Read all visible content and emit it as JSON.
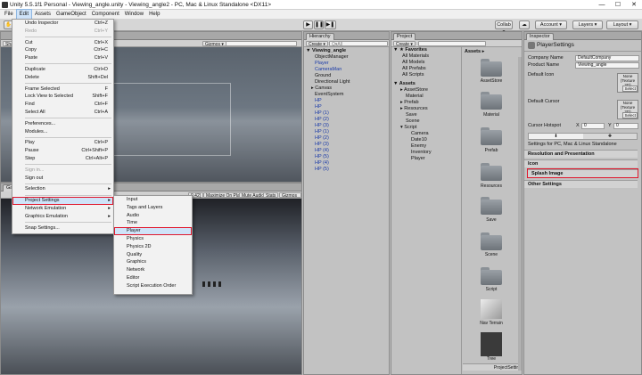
{
  "window": {
    "title": "Unity 5.5.1f1 Personal - Viewing_angle.unity - Viewing_angle2 - PC, Mac & Linux Standalone <DX11>"
  },
  "menubar": [
    "File",
    "Edit",
    "Assets",
    "GameObject",
    "Component",
    "Window",
    "Help"
  ],
  "toolbar": {
    "collab": "Collab ▾",
    "account": "Account ▾",
    "layers": "Layers ▾",
    "layout": "Layout ▾",
    "play": "▶",
    "pause": "❚❚",
    "step": "▶❚"
  },
  "scene": {
    "gizmos": "Gizmos ▾",
    "shaded": "Shaded"
  },
  "game": {
    "tab": "Game",
    "scale": "0.42)",
    "maximize": "Maximize On Play",
    "mute": "Mute Audio",
    "stats": "Stats",
    "gizmos": "Gizmos ▾"
  },
  "hierarchy": {
    "tab": "Hierarchy",
    "create": "Create ▾",
    "search_placeholder": "Q▾All",
    "root": "▼ Viewing_angle",
    "items": [
      "ObjectManager",
      "Player",
      "CameraMan",
      "Ground",
      "Directional Light",
      "Canvas",
      "EventSystem",
      "HP",
      "HP",
      "HP (1)",
      "HP (2)",
      "HP (3)",
      "HP (1)",
      "HP (2)",
      "HP (3)",
      "HP (4)",
      "HP (5)",
      "HP (4)",
      "HP (5)"
    ]
  },
  "project": {
    "tab": "Project",
    "create": "Create ▾",
    "favorites": "▼ ★ Favorites",
    "fav_items": [
      "All Materials",
      "All Models",
      "All Prefabs",
      "All Scripts"
    ],
    "assets_root": "▼ Assets",
    "tree": [
      "AssetStore",
      "Material",
      "Prefab",
      "Resources",
      "Save",
      "Scene",
      "Script",
      "Camera",
      "Date10",
      "Enemy",
      "Inventory",
      "Player"
    ],
    "breadcrumb": "Assets ▸",
    "grid": [
      "AssetStore",
      "Material",
      "Prefab",
      "Resources",
      "Save",
      "Scene",
      "Script",
      "Nav Terrain",
      "Tree"
    ],
    "footer": "ProjectSettir"
  },
  "inspector": {
    "tab": "Inspector",
    "title": "PlayerSettings",
    "company_label": "Company Name",
    "company_value": "DefaultCompany",
    "product_label": "Product Name",
    "product_value": "Viewing_angle",
    "default_icon_label": "Default Icon",
    "default_cursor_label": "Default Cursor",
    "tex_none": "None (Texture 2D)",
    "tex_select": "Select",
    "hotspot_label": "Cursor Hotspot",
    "hotspot_x_label": "X",
    "hotspot_x": "0",
    "hotspot_y_label": "Y",
    "hotspot_y": "0",
    "settings_for": "Settings for PC, Mac & Linux Standalone",
    "sections": [
      "Resolution and Presentation",
      "Icon",
      "Splash Image",
      "Other Settings"
    ]
  },
  "edit_menu": [
    {
      "label": "Undo Inspector",
      "shortcut": "Ctrl+Z"
    },
    {
      "label": "Redo",
      "shortcut": "Ctrl+Y"
    },
    {
      "label": "Cut",
      "shortcut": "Ctrl+X"
    },
    {
      "label": "Copy",
      "shortcut": "Ctrl+C"
    },
    {
      "label": "Paste",
      "shortcut": "Ctrl+V"
    },
    {
      "label": "Duplicate",
      "shortcut": "Ctrl+D"
    },
    {
      "label": "Delete",
      "shortcut": "Shift+Del"
    },
    {
      "label": "Frame Selected",
      "shortcut": "F"
    },
    {
      "label": "Lock View to Selected",
      "shortcut": "Shift+F"
    },
    {
      "label": "Find",
      "shortcut": "Ctrl+F"
    },
    {
      "label": "Select All",
      "shortcut": "Ctrl+A"
    },
    {
      "label": "Preferences...",
      "shortcut": ""
    },
    {
      "label": "Modules...",
      "shortcut": ""
    },
    {
      "label": "Play",
      "shortcut": "Ctrl+P"
    },
    {
      "label": "Pause",
      "shortcut": "Ctrl+Shift+P"
    },
    {
      "label": "Step",
      "shortcut": "Ctrl+Alt+P"
    },
    {
      "label": "Sign in...",
      "shortcut": ""
    },
    {
      "label": "Sign out",
      "shortcut": ""
    },
    {
      "label": "Selection",
      "shortcut": ""
    },
    {
      "label": "Project Settings",
      "shortcut": ""
    },
    {
      "label": "Network Emulation",
      "shortcut": ""
    },
    {
      "label": "Graphics Emulation",
      "shortcut": ""
    },
    {
      "label": "Snap Settings...",
      "shortcut": ""
    }
  ],
  "project_settings_menu": [
    "Input",
    "Tags and Layers",
    "Audio",
    "Time",
    "Player",
    "Physics",
    "Physics 2D",
    "Quality",
    "Graphics",
    "Network",
    "Editor",
    "Script Execution Order"
  ]
}
